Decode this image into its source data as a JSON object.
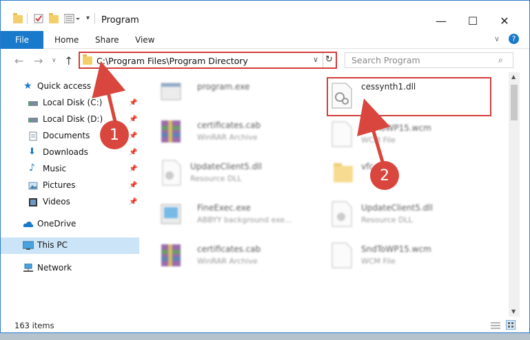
{
  "window": {
    "title": "Program",
    "controls": {
      "minimize": "—",
      "maximize": "☐",
      "close": "✕"
    }
  },
  "ribbon": {
    "tabs": [
      "File",
      "Home",
      "Share",
      "View"
    ],
    "help": "?"
  },
  "navigation": {
    "address": "C:\\Program Files\\Program Directory",
    "search_placeholder": "Search Program"
  },
  "sidebar": {
    "items": [
      {
        "label": "Quick access",
        "icon": "star-icon"
      },
      {
        "label": "Local Disk (C:)",
        "icon": "drive-icon",
        "pinned": true
      },
      {
        "label": "Local Disk (D:)",
        "icon": "drive-icon",
        "pinned": true
      },
      {
        "label": "Documents",
        "icon": "documents-icon",
        "pinned": true
      },
      {
        "label": "Downloads",
        "icon": "download-icon",
        "pinned": true
      },
      {
        "label": "Music",
        "icon": "music-icon",
        "pinned": true
      },
      {
        "label": "Pictures",
        "icon": "pictures-icon",
        "pinned": true
      },
      {
        "label": "Videos",
        "icon": "videos-icon",
        "pinned": true
      },
      {
        "label": "OneDrive",
        "icon": "cloud-icon"
      },
      {
        "label": "This PC",
        "icon": "computer-icon",
        "selected": true
      },
      {
        "label": "Network",
        "icon": "network-icon"
      }
    ]
  },
  "files": {
    "left": [
      {
        "name": "program.exe",
        "type": ""
      },
      {
        "name": "certificates.cab",
        "type": "WinRAR Archive"
      },
      {
        "name": "UpdateClient5.dll",
        "type": "Resource DLL"
      },
      {
        "name": "FineExec.exe",
        "type": "ABBYY background exe..."
      },
      {
        "name": "certificates.cab",
        "type": "WinRAR Archive"
      }
    ],
    "right": [
      {
        "name": "cessynth1.dll",
        "type": ""
      },
      {
        "name": "SndToWP15.wcm",
        "type": "WCM File"
      },
      {
        "name": "vfc",
        "type": ""
      },
      {
        "name": "UpdateClient5.dll",
        "type": "Resource DLL"
      },
      {
        "name": "SndToWP15.wcm",
        "type": "WCM File"
      }
    ]
  },
  "annotations": {
    "step1": "1",
    "step2": "2"
  },
  "status": {
    "count": "163 items"
  },
  "colors": {
    "accent": "#1979ca",
    "highlight": "#d23a3a",
    "badge": "#d9463e"
  }
}
